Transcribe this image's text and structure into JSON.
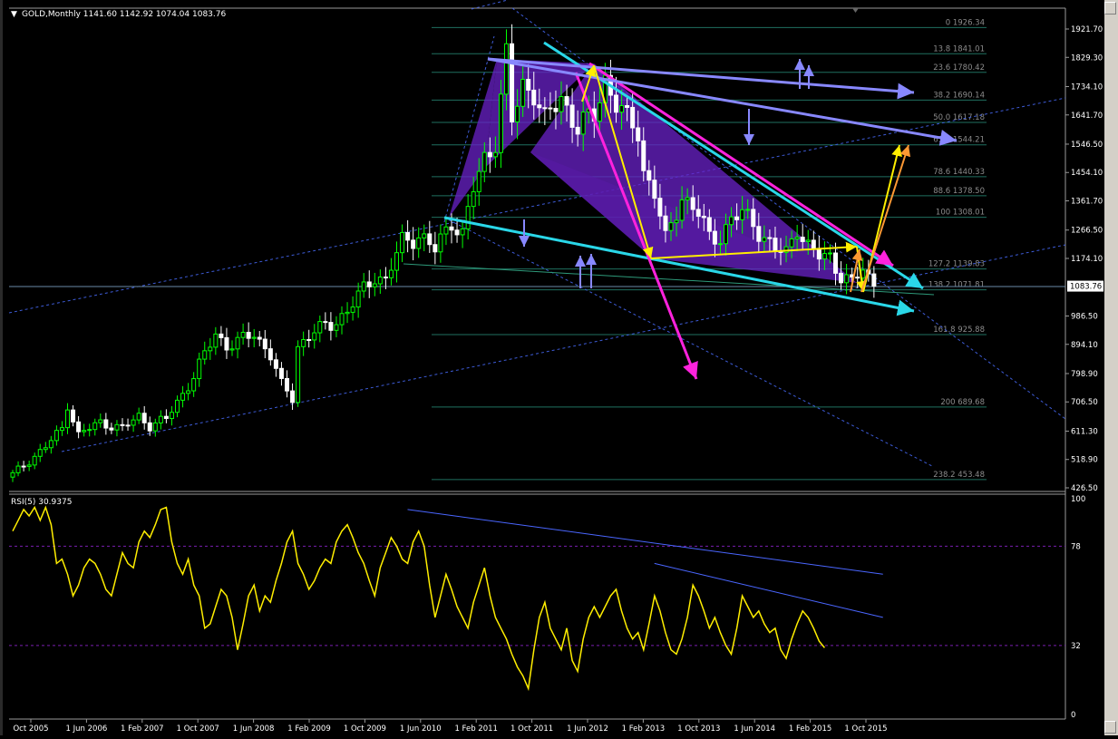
{
  "window": {
    "symbol_header": "GOLD,Monthly  1141.60 1142.92 1074.04 1083.76",
    "rsi_header": "RSI(5) 30.9375"
  },
  "colors": {
    "background": "#000000",
    "bull_candle": "#00ff00",
    "bear_candle": "#ffffff",
    "price_axis_text": "#ffffff",
    "fib_level": "#1f6f5f",
    "fib_text": "#8c8c8c",
    "trend_dashed": "#3d5bd6",
    "cyan": "#2ad7e8",
    "magenta": "#ff22dd",
    "yellow": "#ffee00",
    "orange": "#ff9933",
    "lavender": "#8888ff",
    "pattern_fill": "#6a22c8",
    "rsi_line": "#ffee00",
    "rsi_trend": "#4a66ff",
    "rsi_level": "#7a1fb0"
  },
  "chart_data": [
    {
      "type": "candlestick",
      "title": "GOLD,Monthly",
      "ohlc_last": {
        "open": 1141.6,
        "high": 1142.92,
        "low": 1074.04,
        "close": 1083.76
      },
      "current_price_label": "1083.76",
      "ylim": [
        426.5,
        1960
      ],
      "y_ticks": [
        "1921.70",
        "1829.30",
        "1734.10",
        "1641.70",
        "1546.50",
        "1454.10",
        "1361.70",
        "1266.50",
        "1174.10",
        "1083.76",
        "986.50",
        "894.10",
        "798.90",
        "706.50",
        "611.30",
        "518.90",
        "426.50"
      ],
      "x_ticks": [
        "Oct 2005",
        "1 Jun 2006",
        "1 Feb 2007",
        "1 Oct 2007",
        "1 Jun 2008",
        "1 Feb 2009",
        "1 Oct 2009",
        "1 Jun 2010",
        "1 Feb 2011",
        "1 Oct 2011",
        "1 Jun 2012",
        "1 Feb 2013",
        "1 Oct 2013",
        "1 Jun 2014",
        "1 Feb 2015",
        "1 Oct 2015"
      ],
      "fib_levels": [
        {
          "label": "0 1926.34",
          "value": 1926.34
        },
        {
          "label": "13.8 1841.01",
          "value": 1841.01
        },
        {
          "label": "23.6 1780.42",
          "value": 1780.42
        },
        {
          "label": "38.2 1690.14",
          "value": 1690.14
        },
        {
          "label": "50.0 1617.18",
          "value": 1617.18
        },
        {
          "label": "61.8 1544.21",
          "value": 1544.21
        },
        {
          "label": "78.6 1440.33",
          "value": 1440.33
        },
        {
          "label": "88.6 1378.50",
          "value": 1378.5
        },
        {
          "label": "100 1308.01",
          "value": 1308.01
        },
        {
          "label": "127.2 1139.83",
          "value": 1139.83
        },
        {
          "label": "138.2 1071.81",
          "value": 1071.81
        },
        {
          "label": "161.8 925.88",
          "value": 925.88
        },
        {
          "label": "200 689.68",
          "value": 689.68
        },
        {
          "label": "238.2 453.48",
          "value": 453.48
        }
      ],
      "anchors": [
        {
          "i": 0,
          "c": 470
        },
        {
          "i": 6,
          "c": 560
        },
        {
          "i": 9,
          "c": 620
        },
        {
          "i": 10,
          "c": 700
        },
        {
          "i": 12,
          "c": 600
        },
        {
          "i": 16,
          "c": 640
        },
        {
          "i": 20,
          "c": 620
        },
        {
          "i": 23,
          "c": 660
        },
        {
          "i": 25,
          "c": 630
        },
        {
          "i": 28,
          "c": 650
        },
        {
          "i": 33,
          "c": 790
        },
        {
          "i": 37,
          "c": 930
        },
        {
          "i": 39,
          "c": 890
        },
        {
          "i": 41,
          "c": 900
        },
        {
          "i": 44,
          "c": 930
        },
        {
          "i": 47,
          "c": 860
        },
        {
          "i": 49,
          "c": 760
        },
        {
          "i": 51,
          "c": 720
        },
        {
          "i": 52,
          "c": 890
        },
        {
          "i": 55,
          "c": 935
        },
        {
          "i": 58,
          "c": 960
        },
        {
          "i": 61,
          "c": 1000
        },
        {
          "i": 63,
          "c": 1050
        },
        {
          "i": 66,
          "c": 1120
        },
        {
          "i": 68,
          "c": 1100
        },
        {
          "i": 71,
          "c": 1230
        },
        {
          "i": 74,
          "c": 1250
        },
        {
          "i": 77,
          "c": 1200
        },
        {
          "i": 80,
          "c": 1300
        },
        {
          "i": 82,
          "c": 1250
        },
        {
          "i": 84,
          "c": 1400
        },
        {
          "i": 86,
          "c": 1500
        },
        {
          "i": 88,
          "c": 1560
        },
        {
          "i": 90,
          "c": 1830
        },
        {
          "i": 91,
          "c": 1620
        },
        {
          "i": 93,
          "c": 1740
        },
        {
          "i": 95,
          "c": 1720
        },
        {
          "i": 97,
          "c": 1620
        },
        {
          "i": 100,
          "c": 1700
        },
        {
          "i": 103,
          "c": 1600
        },
        {
          "i": 106,
          "c": 1640
        },
        {
          "i": 108,
          "c": 1760
        },
        {
          "i": 110,
          "c": 1680
        },
        {
          "i": 112,
          "c": 1620
        },
        {
          "i": 114,
          "c": 1590
        },
        {
          "i": 115,
          "c": 1460
        },
        {
          "i": 117,
          "c": 1390
        },
        {
          "i": 119,
          "c": 1230
        },
        {
          "i": 121,
          "c": 1330
        },
        {
          "i": 122,
          "c": 1380
        },
        {
          "i": 125,
          "c": 1320
        },
        {
          "i": 127,
          "c": 1240
        },
        {
          "i": 129,
          "c": 1250
        },
        {
          "i": 131,
          "c": 1300
        },
        {
          "i": 133,
          "c": 1320
        },
        {
          "i": 135,
          "c": 1290
        },
        {
          "i": 138,
          "c": 1220
        },
        {
          "i": 139,
          "c": 1200
        },
        {
          "i": 141,
          "c": 1190
        },
        {
          "i": 143,
          "c": 1280
        },
        {
          "i": 145,
          "c": 1210
        },
        {
          "i": 147,
          "c": 1180
        },
        {
          "i": 149,
          "c": 1180
        },
        {
          "i": 151,
          "c": 1120
        },
        {
          "i": 153,
          "c": 1090
        },
        {
          "i": 155,
          "c": 1140
        },
        {
          "i": 157,
          "c": 1083.76
        }
      ],
      "annotations": {
        "trend_lines": [
          {
            "color": "cyan",
            "points": [
              [
                1,
                1860
              ],
              [
                1000,
                1035
              ]
            ]
          },
          {
            "color": "cyan",
            "points": [
              [
                0,
                1320
              ],
              [
                980,
                1000
              ]
            ]
          },
          {
            "color": "magenta",
            "points": [
              [
                0,
                1810
              ],
              [
                360,
                1180
              ]
            ]
          },
          {
            "color": "lavender",
            "points": [
              [
                0,
                1840
              ],
              [
                470,
                1735
              ]
            ]
          },
          {
            "color": "lavender",
            "points": [
              [
                0,
                1845
              ],
              [
                510,
                1540
              ]
            ]
          }
        ]
      }
    },
    {
      "type": "line",
      "title": "RSI(5) 30.9375",
      "ylim": [
        0,
        100
      ],
      "y_ticks": [
        "100",
        "78",
        "32",
        "0"
      ],
      "levels": [
        78,
        32
      ],
      "values": [
        85,
        90,
        95,
        92,
        96,
        90,
        96,
        88,
        70,
        72,
        65,
        55,
        60,
        68,
        72,
        70,
        65,
        58,
        55,
        65,
        75,
        70,
        68,
        80,
        85,
        82,
        88,
        95,
        96,
        80,
        70,
        65,
        72,
        60,
        55,
        40,
        42,
        50,
        58,
        55,
        45,
        30,
        42,
        55,
        60,
        48,
        55,
        52,
        62,
        70,
        80,
        85,
        70,
        65,
        58,
        62,
        68,
        72,
        70,
        80,
        85,
        88,
        82,
        75,
        70,
        62,
        55,
        68,
        75,
        82,
        78,
        72,
        70,
        80,
        85,
        78,
        60,
        45,
        55,
        65,
        58,
        50,
        45,
        40,
        52,
        60,
        68,
        55,
        45,
        40,
        35,
        28,
        22,
        18,
        12,
        30,
        45,
        52,
        40,
        35,
        30,
        40,
        25,
        20,
        35,
        45,
        50,
        45,
        50,
        55,
        58,
        48,
        40,
        35,
        38,
        30,
        42,
        55,
        48,
        38,
        30,
        28,
        35,
        45,
        60,
        55,
        48,
        40,
        45,
        38,
        32,
        28,
        40,
        55,
        50,
        45,
        48,
        42,
        38,
        40,
        30,
        26,
        35,
        42,
        48,
        45,
        40,
        34,
        30.9375
      ],
      "trend_lines": [
        {
          "from": [
            70,
            95
          ],
          "to": [
            155,
            65
          ]
        },
        {
          "from": [
            115,
            70
          ],
          "to": [
            155,
            45
          ]
        }
      ]
    }
  ]
}
